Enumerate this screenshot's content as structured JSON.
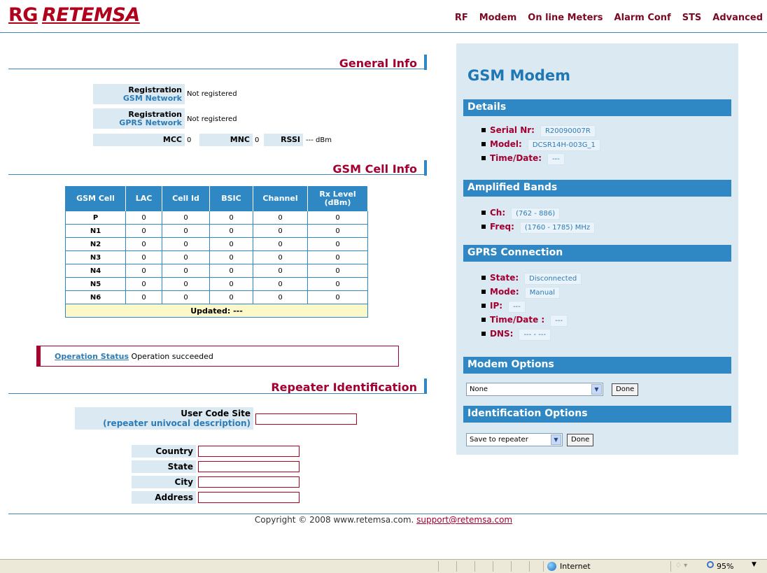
{
  "brand": {
    "rg": "RG",
    "name": "RETEMSA"
  },
  "nav": [
    "RF",
    "Modem",
    "On line Meters",
    "Alarm Conf",
    "STS",
    "Advanced"
  ],
  "general_info": {
    "title": "General Info",
    "reg_gsm_label": "Registration",
    "reg_gsm_sub": "GSM Network",
    "reg_gsm_value": "Not registered",
    "reg_gprs_label": "Registration",
    "reg_gprs_sub": "GPRS Network",
    "reg_gprs_value": "Not registered",
    "mcc_label": "MCC",
    "mcc_value": "0",
    "mnc_label": "MNC",
    "mnc_value": "0",
    "rssi_label": "RSSI",
    "rssi_value": "--- dBm"
  },
  "gsm_cell_info": {
    "title": "GSM Cell Info",
    "headers": [
      "GSM Cell",
      "LAC",
      "Cell Id",
      "BSIC",
      "Channel",
      "Rx Level (dBm)"
    ],
    "rows": [
      [
        "P",
        "0",
        "0",
        "0",
        "0",
        "0"
      ],
      [
        "N1",
        "0",
        "0",
        "0",
        "0",
        "0"
      ],
      [
        "N2",
        "0",
        "0",
        "0",
        "0",
        "0"
      ],
      [
        "N3",
        "0",
        "0",
        "0",
        "0",
        "0"
      ],
      [
        "N4",
        "0",
        "0",
        "0",
        "0",
        "0"
      ],
      [
        "N5",
        "0",
        "0",
        "0",
        "0",
        "0"
      ],
      [
        "N6",
        "0",
        "0",
        "0",
        "0",
        "0"
      ]
    ],
    "updated": "Updated: ---"
  },
  "operation_status": {
    "link": "Operation Status",
    "text": "Operation succeeded"
  },
  "repeater_identification": {
    "title": "Repeater Identification",
    "user_code_label": "User Code Site",
    "user_code_sub": "(repeater univocal description)",
    "user_code_value": "",
    "country_label": "Country",
    "country_value": "",
    "state_label": "State",
    "state_value": "",
    "city_label": "City",
    "city_value": "",
    "address_label": "Address",
    "address_value": ""
  },
  "panel": {
    "title": "GSM Modem",
    "details_title": "Details",
    "serial_label": "Serial Nr:",
    "serial_value": "R20090007R",
    "model_label": "Model:",
    "model_value": "DCSR14H-003G_1",
    "time_label": "Time/Date:",
    "time_value": "---",
    "bands_title": "Amplified Bands",
    "ch_label": "Ch:",
    "ch_value": "(762 - 886)",
    "freq_label": "Freq:",
    "freq_value": "(1760 - 1785) MHz",
    "gprs_title": "GPRS Connection",
    "state_label": "State:",
    "state_value": "Disconnected",
    "mode_label": "Mode:",
    "mode_value": "Manual",
    "ip_label": "IP:",
    "ip_value": "---",
    "gtime_label": "Time/Date :",
    "gtime_value": "---",
    "dns_label": "DNS:",
    "dns_value": "--- - ---",
    "modem_opts_title": "Modem Options",
    "modem_opts_selected": "None",
    "modem_opts_done": "Done",
    "ident_opts_title": "Identification Options",
    "ident_opts_selected": "Save to repeater",
    "ident_opts_done": "Done"
  },
  "footer": {
    "text": "Copyright © 2008 www.retemsa.com.",
    "email": "support@retemsa.com"
  },
  "statusbar": {
    "zone": "Internet",
    "zoom": "95%"
  }
}
